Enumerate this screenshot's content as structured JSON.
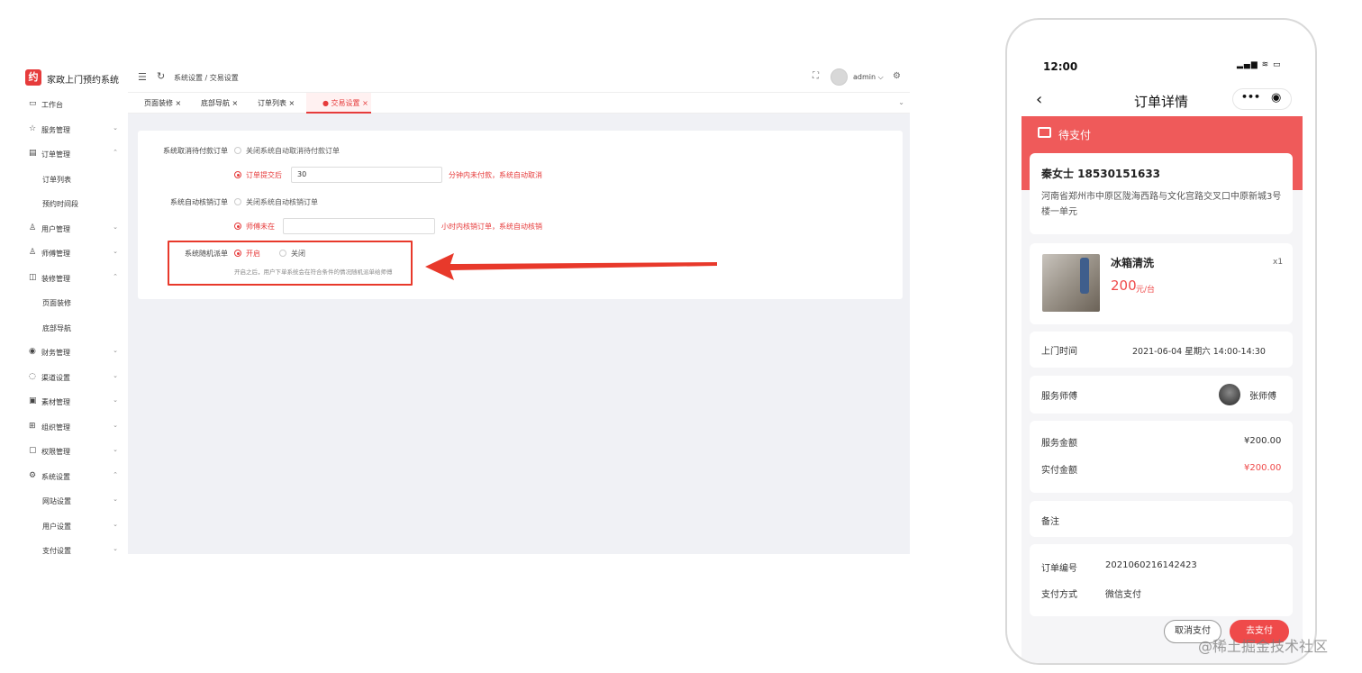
{
  "admin": {
    "app_title": "家政上门预约系统",
    "logo_glyph": "约",
    "breadcrumb": "系统设置 / 交易设置",
    "user": "admin ⌵",
    "sidebar": [
      {
        "icon": "▭",
        "label": "工作台",
        "chev": "",
        "sub": false
      },
      {
        "icon": "☆",
        "label": "服务管理",
        "chev": "⌄",
        "sub": false
      },
      {
        "icon": "▤",
        "label": "订单管理",
        "chev": "⌃",
        "sub": false
      },
      {
        "icon": "",
        "label": "订单列表",
        "chev": "",
        "sub": true
      },
      {
        "icon": "",
        "label": "预约时间段",
        "chev": "",
        "sub": true
      },
      {
        "icon": "♙",
        "label": "用户管理",
        "chev": "⌄",
        "sub": false
      },
      {
        "icon": "♙",
        "label": "师傅管理",
        "chev": "⌄",
        "sub": false
      },
      {
        "icon": "◫",
        "label": "装修管理",
        "chev": "⌃",
        "sub": false
      },
      {
        "icon": "",
        "label": "页面装修",
        "chev": "",
        "sub": true
      },
      {
        "icon": "",
        "label": "底部导航",
        "chev": "",
        "sub": true
      },
      {
        "icon": "◉",
        "label": "财务管理",
        "chev": "⌄",
        "sub": false
      },
      {
        "icon": "◌",
        "label": "渠道设置",
        "chev": "⌄",
        "sub": false
      },
      {
        "icon": "▣",
        "label": "素材管理",
        "chev": "⌄",
        "sub": false
      },
      {
        "icon": "⊞",
        "label": "组织管理",
        "chev": "⌄",
        "sub": false
      },
      {
        "icon": "▢",
        "label": "权限管理",
        "chev": "⌄",
        "sub": false
      },
      {
        "icon": "⚙",
        "label": "系统设置",
        "chev": "⌃",
        "sub": false
      },
      {
        "icon": "",
        "label": "网站设置",
        "chev": "⌄",
        "sub": true
      },
      {
        "icon": "",
        "label": "用户设置",
        "chev": "⌄",
        "sub": true
      },
      {
        "icon": "",
        "label": "支付设置",
        "chev": "⌄",
        "sub": true
      }
    ],
    "tabs": [
      {
        "label": "页面装修 ×",
        "active": false
      },
      {
        "label": "底部导航 ×",
        "active": false
      },
      {
        "label": "订单列表 ×",
        "active": false
      },
      {
        "label": "● 交易设置 ×",
        "active": true
      }
    ],
    "settings": {
      "cancel_label": "系统取消待付款订单",
      "cancel_opt_off": "关闭系统自动取消待付款订单",
      "cancel_opt_on": "订单提交后",
      "cancel_minutes": "30",
      "cancel_hint": "分钟内未付款，系统自动取消",
      "verify_label": "系统自动核销订单",
      "verify_opt_off": "关闭系统自动核销订单",
      "verify_opt_on": "师傅未在",
      "verify_hours": "",
      "verify_hint": "小时内核销订单，系统自动核销",
      "dispatch_label": "系统随机派单",
      "dispatch_on": "开启",
      "dispatch_off": "关闭",
      "dispatch_hint": "开启之后，用户下单系统会在符合条件的情况随机派单给师傅"
    },
    "arrow_color": "#e8392b"
  },
  "phone": {
    "time": "12:00",
    "status_icons": "▂▄▆ ≋ ▭",
    "back": "‹",
    "title": "订单详情",
    "capsule_more": "•••",
    "capsule_target": "◉",
    "order_status": "待支付",
    "customer": "秦女士 18530151633",
    "address": "河南省郑州市中原区陇海西路与文化宫路交叉口中原新城3号楼一单元",
    "product_name": "冰箱清洗",
    "product_qty": "x1",
    "product_price": "200",
    "product_unit": "元/台",
    "visit_label": "上门时间",
    "visit_value": "2021-06-04 星期六 14:00-14:30",
    "master_label": "服务师傅",
    "master_name": "张师傅",
    "amount_label": "服务金额",
    "amount_value": "¥200.00",
    "paid_label": "实付金额",
    "paid_value": "¥200.00",
    "remark_label": "备注",
    "order_no_label": "订单编号",
    "order_no": "2021060216142423",
    "pay_method_label": "支付方式",
    "pay_method": "微信支付",
    "cancel_btn": "取消支付",
    "pay_btn": "去支付",
    "accent": "#ef4a4a"
  },
  "watermark": "@稀土掘金技术社区"
}
